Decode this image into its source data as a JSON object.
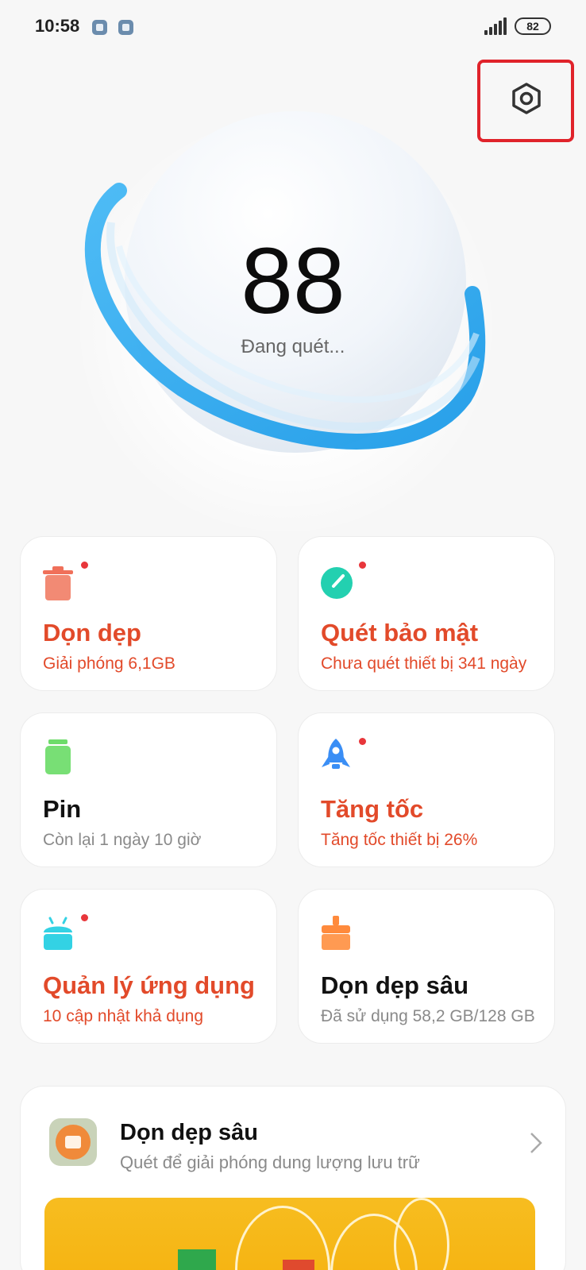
{
  "status_bar": {
    "time": "10:58",
    "battery": "82"
  },
  "hero": {
    "score": "88",
    "status": "Đang quét..."
  },
  "cards": [
    {
      "title": "Dọn dẹp",
      "subtitle": "Giải phóng 6,1GB",
      "icon": "trash-icon",
      "color": "#f0705a",
      "badge": true
    },
    {
      "title": "Quét bảo mật",
      "subtitle": "Chưa quét thiết bị 341 ngày",
      "icon": "security-scan-icon",
      "color": "#23d0b0",
      "badge": true
    },
    {
      "title": "Pin",
      "subtitle": "Còn lại 1 ngày 10 giờ",
      "icon": "battery-icon",
      "color": "#6ddc6a",
      "badge": false
    },
    {
      "title": "Tăng tốc",
      "subtitle": "Tăng tốc thiết bị 26%",
      "icon": "rocket-icon",
      "color": "#3a8ef5",
      "badge": true
    },
    {
      "title": "Quản lý ứng dụng",
      "subtitle": "10 cập nhật khả dụng",
      "icon": "android-icon",
      "color": "#33d2e4",
      "badge": true
    },
    {
      "title": "Dọn dẹp sâu",
      "subtitle": "Đã sử dụng 58,2 GB/128 GB",
      "icon": "brush-icon",
      "color": "#ff8a3c",
      "badge": false
    }
  ],
  "banner": {
    "title": "Dọn dẹp sâu",
    "subtitle": "Quét để giải phóng dung lượng lưu trữ"
  },
  "colors": {
    "accent_red": "#e24a2a",
    "highlight": "#e0232b",
    "ring_blue": "#2aa7f0"
  }
}
